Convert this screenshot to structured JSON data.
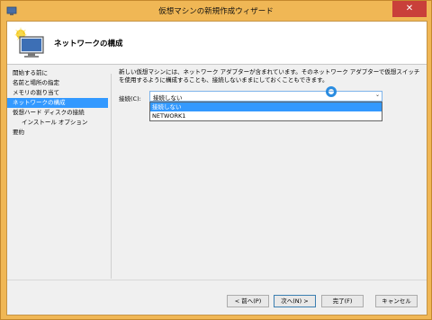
{
  "window": {
    "title": "仮想マシンの新規作成ウィザード",
    "close_glyph": "✕"
  },
  "header": {
    "title": "ネットワークの構成",
    "icon": "vm-monitor-icon"
  },
  "nav": {
    "items": [
      {
        "label": "開始する前に"
      },
      {
        "label": "名前と場所の指定"
      },
      {
        "label": "メモリの割り当て"
      },
      {
        "label": "ネットワークの構成"
      },
      {
        "label": "仮想ハード ディスクの接続"
      },
      {
        "label": "インストール オプション"
      },
      {
        "label": "要約"
      }
    ],
    "active_index": 3
  },
  "content": {
    "description": "新しい仮想マシンには、ネットワーク アダプターが含まれています。そのネットワーク アダプターで仮想スイッチを使用するように構成することも、接続しないままにしておくこともできます。",
    "connection_label": "接続(C):",
    "select_value": "接続しない",
    "options": [
      "接続しない",
      "NETWORK1"
    ]
  },
  "buttons": {
    "prev": "< 前へ(P)",
    "next": "次へ(N) >",
    "finish": "完了(F)",
    "cancel": "キャンセル"
  },
  "colors": {
    "accent": "#3399ff",
    "frame": "#f0b755",
    "close": "#c9403a"
  }
}
